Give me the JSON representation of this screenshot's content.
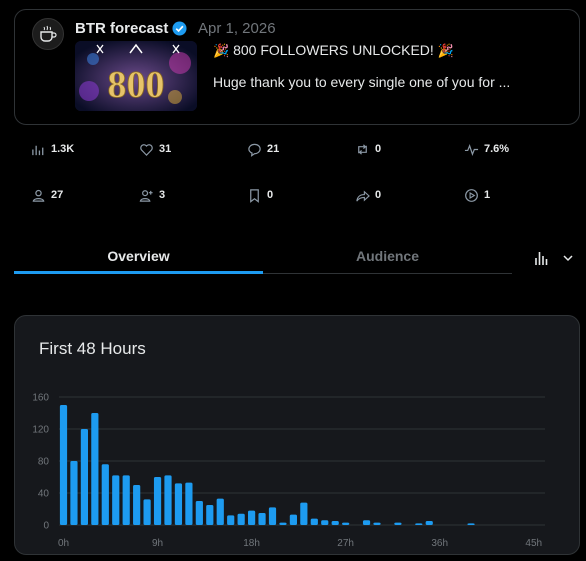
{
  "post": {
    "author": "BTR forecast",
    "date": "Apr 1, 2026",
    "headline": "800 FOLLOWERS UNLOCKED!",
    "excerpt": "Huge thank you to every single one of you for ...",
    "thumbnail_text": "800",
    "party_emoji": "🎉"
  },
  "metrics_row1": [
    {
      "icon": "impressions-icon",
      "value": "1.3K"
    },
    {
      "icon": "like-icon",
      "value": "31"
    },
    {
      "icon": "reply-icon",
      "value": "21"
    },
    {
      "icon": "repost-icon",
      "value": "0"
    },
    {
      "icon": "engagement-rate-icon",
      "value": "7.6%"
    }
  ],
  "metrics_row2": [
    {
      "icon": "profile-visits-icon",
      "value": "27"
    },
    {
      "icon": "follows-icon",
      "value": "3"
    },
    {
      "icon": "bookmark-icon",
      "value": "0"
    },
    {
      "icon": "share-icon",
      "value": "0"
    },
    {
      "icon": "video-views-icon",
      "value": "1"
    }
  ],
  "tabs": [
    {
      "label": "Overview",
      "active": true
    },
    {
      "label": "Audience",
      "active": false
    }
  ],
  "colors": {
    "accent": "#1d9bf0",
    "bar": "#1d9bf0",
    "muted": "#71767b"
  },
  "chart_data": {
    "type": "bar",
    "title": "First 48 Hours",
    "xlabel": "",
    "ylabel": "",
    "ylim": [
      0,
      160
    ],
    "yticks": [
      0,
      40,
      80,
      120,
      160
    ],
    "xticks": [
      "0h",
      "9h",
      "18h",
      "27h",
      "36h",
      "45h"
    ],
    "xtick_hours": [
      0,
      9,
      18,
      27,
      36,
      45
    ],
    "grid": true,
    "hours": [
      0,
      1,
      2,
      3,
      4,
      5,
      6,
      7,
      8,
      9,
      10,
      11,
      12,
      13,
      14,
      15,
      16,
      17,
      18,
      19,
      20,
      21,
      22,
      23,
      24,
      25,
      26,
      27,
      28,
      29,
      30,
      31,
      32,
      33,
      34,
      35,
      36,
      37,
      38,
      39,
      40,
      41,
      42,
      43,
      44,
      45,
      46,
      47
    ],
    "values": [
      150,
      80,
      120,
      140,
      76,
      62,
      62,
      50,
      32,
      60,
      62,
      52,
      53,
      30,
      25,
      33,
      12,
      14,
      18,
      15,
      22,
      3,
      13,
      28,
      8,
      6,
      5,
      3,
      0,
      6,
      3,
      0,
      3,
      0,
      2,
      5,
      0,
      0,
      0,
      2,
      0,
      0,
      0,
      0,
      0,
      0,
      0,
      0
    ]
  }
}
